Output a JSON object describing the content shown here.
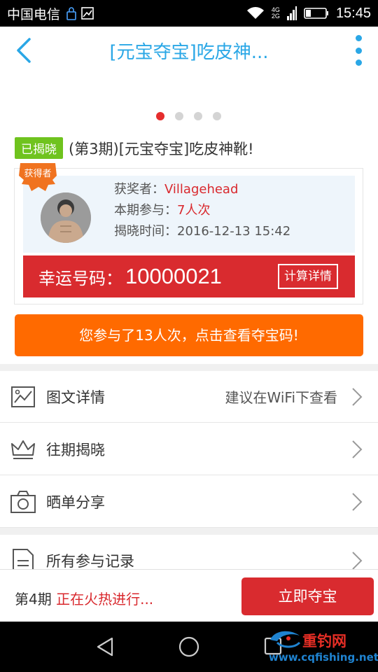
{
  "status_bar": {
    "carrier": "中国电信",
    "network": [
      "4G",
      "2G"
    ],
    "time": "15:45"
  },
  "header": {
    "title": "[元宝夺宝]吃皮神...",
    "accent_color": "#2aa7e6"
  },
  "carousel": {
    "active_index": 0,
    "count": 4
  },
  "product": {
    "badge": "已揭晓",
    "title": "(第3期)[元宝夺宝]吃皮神靴!"
  },
  "winner": {
    "ribbon": "获得者",
    "name_label": "获奖者：",
    "name": "Villagehead",
    "join_label": "本期参与：",
    "join_value": "7人次",
    "time_label": "揭晓时间：",
    "time_value": "2016-12-13 15:42",
    "lucky_label": "幸运号码：",
    "lucky_number": "10000021",
    "calc_button": "计算详情"
  },
  "participation_button": "您参与了13人次，点击查看夺宝码!",
  "list": [
    {
      "icon": "image-icon",
      "label": "图文详情",
      "hint": "建议在WiFi下查看"
    },
    {
      "icon": "crown-icon",
      "label": "往期揭晓",
      "hint": ""
    },
    {
      "icon": "camera-icon",
      "label": "晒单分享",
      "hint": ""
    },
    {
      "icon": "document-icon",
      "label": "所有参与记录",
      "hint": ""
    }
  ],
  "bottom_bar": {
    "period": "第4期",
    "status": "正在火热进行...",
    "buy_button": "立即夺宝"
  },
  "watermark": {
    "brand": "重钓网",
    "url": "www.cqfishing.net"
  },
  "colors": {
    "red": "#d92b2f",
    "orange": "#ff6a00",
    "green": "#6fc31e",
    "blue": "#2aa7e6"
  }
}
